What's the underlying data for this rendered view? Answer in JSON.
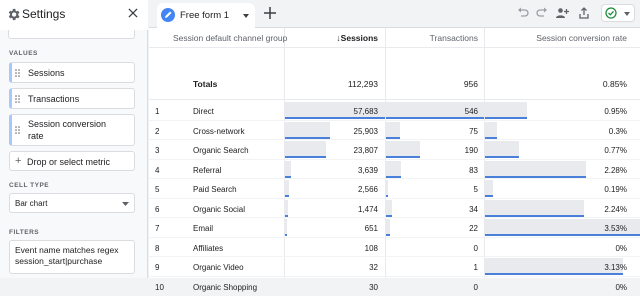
{
  "panel": {
    "title": "Settings",
    "values_label": "VALUES",
    "metrics": [
      {
        "label": "Sessions"
      },
      {
        "label": "Transactions"
      },
      {
        "label_line1": "Session conversion",
        "label_line2": "rate"
      }
    ],
    "drop_label": "Drop or select metric",
    "cell_type_label": "CELL TYPE",
    "cell_type_value": "Bar chart",
    "filters_label": "FILTERS",
    "filter_line1": "Event name matches regex",
    "filter_line2": "session_start|purchase"
  },
  "tab": {
    "label": "Free form 1"
  },
  "table": {
    "headers": {
      "dimension": "Session default channel group",
      "sessions": "↓Sessions",
      "transactions": "Transactions",
      "rate": "Session conversion rate"
    },
    "totals": {
      "label": "Totals",
      "sessions": "112,293",
      "transactions": "956",
      "rate": "0.85%"
    },
    "rows": [
      {
        "n": "1",
        "channel": "Direct",
        "sessions": "57,683",
        "transactions": "546",
        "rate": "0.95%",
        "s_frac": 1.0,
        "t_frac": 1.0,
        "r_frac": 0.27
      },
      {
        "n": "2",
        "channel": "Cross-network",
        "sessions": "25,903",
        "transactions": "75",
        "rate": "0.3%",
        "s_frac": 0.45,
        "t_frac": 0.14,
        "r_frac": 0.08
      },
      {
        "n": "3",
        "channel": "Organic Search",
        "sessions": "23,807",
        "transactions": "190",
        "rate": "0.77%",
        "s_frac": 0.41,
        "t_frac": 0.35,
        "r_frac": 0.22
      },
      {
        "n": "4",
        "channel": "Referral",
        "sessions": "3,639",
        "transactions": "83",
        "rate": "2.28%",
        "s_frac": 0.06,
        "t_frac": 0.15,
        "r_frac": 0.65
      },
      {
        "n": "5",
        "channel": "Paid Search",
        "sessions": "2,566",
        "transactions": "5",
        "rate": "0.19%",
        "s_frac": 0.04,
        "t_frac": 0.01,
        "r_frac": 0.05
      },
      {
        "n": "6",
        "channel": "Organic Social",
        "sessions": "1,474",
        "transactions": "34",
        "rate": "2.24%",
        "s_frac": 0.03,
        "t_frac": 0.06,
        "r_frac": 0.64
      },
      {
        "n": "7",
        "channel": "Email",
        "sessions": "651",
        "transactions": "22",
        "rate": "3.53%",
        "s_frac": 0.01,
        "t_frac": 0.04,
        "r_frac": 1.0
      },
      {
        "n": "8",
        "channel": "Affiliates",
        "sessions": "108",
        "transactions": "0",
        "rate": "0%",
        "s_frac": 0.0,
        "t_frac": 0.0,
        "r_frac": 0.0
      },
      {
        "n": "9",
        "channel": "Organic Video",
        "sessions": "32",
        "transactions": "1",
        "rate": "3.13%",
        "s_frac": 0.0,
        "t_frac": 0.0,
        "r_frac": 0.89
      },
      {
        "n": "10",
        "channel": "Organic Shopping",
        "sessions": "30",
        "transactions": "0",
        "rate": "0%",
        "s_frac": 0.0,
        "t_frac": 0.0,
        "r_frac": 0.0
      }
    ]
  },
  "colors": {
    "accent": "#4285f4",
    "bar_bg": "#e8eaed",
    "bar_line": "#4a80d9",
    "check": "#1e8e3e"
  },
  "icons": [
    "gear-icon",
    "close-icon",
    "drag-handle-icon",
    "plus-icon",
    "chevron-down-icon",
    "pencil-icon",
    "undo-icon",
    "redo-icon",
    "share-icon",
    "add-user-icon",
    "check-circle-icon"
  ]
}
